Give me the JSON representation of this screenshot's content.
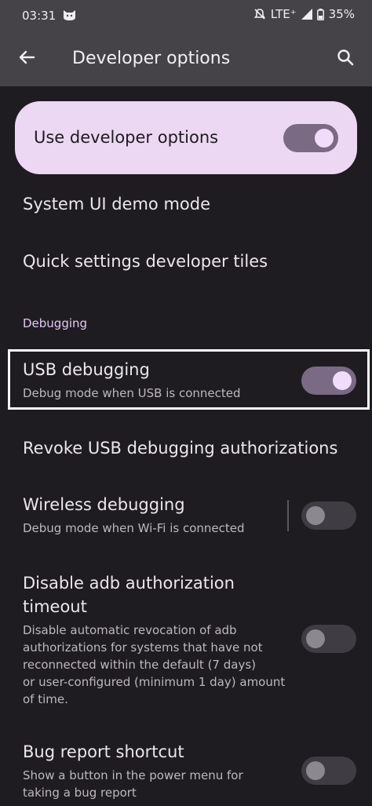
{
  "status_bar": {
    "time": "03:31",
    "network": "LTE⁺",
    "battery": "35%"
  },
  "app_bar": {
    "title": "Developer options"
  },
  "master_switch": {
    "label": "Use developer options",
    "on": true
  },
  "items": [
    {
      "title": "System UI demo mode"
    },
    {
      "title": "Quick settings developer tiles"
    }
  ],
  "section": {
    "header": "Debugging"
  },
  "usb_debugging": {
    "title": "USB debugging",
    "subtitle": "Debug mode when USB is connected",
    "on": true
  },
  "revoke": {
    "title": "Revoke USB debugging authorizations"
  },
  "wireless": {
    "title": "Wireless debugging",
    "subtitle": "Debug mode when Wi-Fi is connected",
    "on": false
  },
  "adb_timeout": {
    "title_line1": "Disable adb authorization",
    "title_line2": "timeout",
    "subtitle_lines": [
      "Disable automatic revocation of adb",
      "authorizations for systems that have not",
      "reconnected within the default (7 days)",
      "or user-configured (minimum 1 day) amount",
      "of time."
    ],
    "on": false
  },
  "bug_report": {
    "title": "Bug report shortcut",
    "subtitle_lines": [
      "Show a button in the power menu for",
      "taking a bug report"
    ],
    "on": false
  },
  "icons": [
    "cat-icon",
    "dnd-off-icon",
    "signal-icon",
    "battery-icon",
    "back-arrow-icon",
    "search-icon"
  ]
}
